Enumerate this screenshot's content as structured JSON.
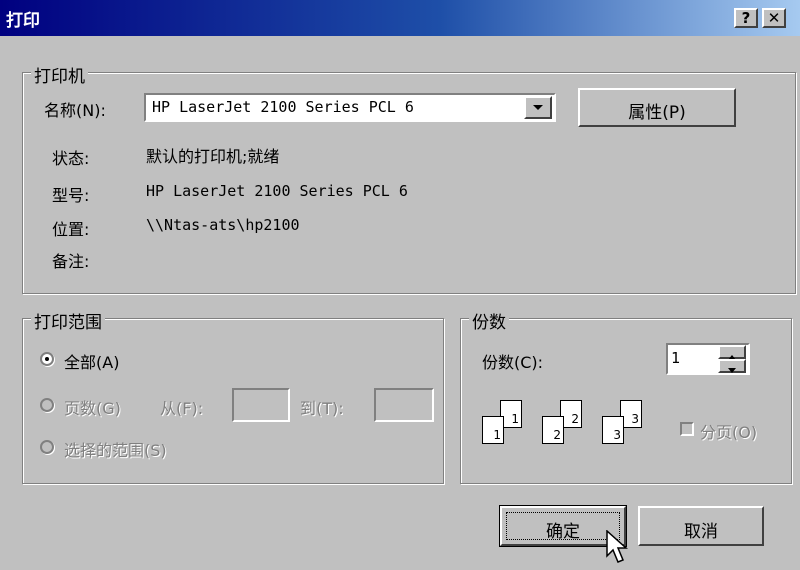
{
  "window": {
    "title": "打印",
    "help_label": "?",
    "close_label": "✕"
  },
  "printer": {
    "group_label": "打印机",
    "name_label": "名称(N):",
    "name_value": "HP LaserJet 2100 Series PCL 6",
    "properties_button": "属性(P)",
    "status_label": "状态:",
    "status_value": "默认的打印机;就绪",
    "model_label": "型号:",
    "model_value": "HP LaserJet 2100 Series PCL 6",
    "location_label": "位置:",
    "location_value": "\\\\Ntas-ats\\hp2100",
    "comment_label": "备注:"
  },
  "range": {
    "group_label": "打印范围",
    "all_label": "全部(A)",
    "pages_label": "页数(G)",
    "from_label": "从(F):",
    "to_label": "到(T):",
    "selection_label": "选择的范围(S)",
    "selected": "all"
  },
  "copies": {
    "group_label": "份数",
    "copies_label": "份数(C):",
    "copies_value": "1",
    "collate_label": "分页(O)",
    "collate_checked": false,
    "page_numbers": [
      "1",
      "1",
      "2",
      "2",
      "3",
      "3"
    ]
  },
  "buttons": {
    "ok": "确定",
    "cancel": "取消"
  }
}
